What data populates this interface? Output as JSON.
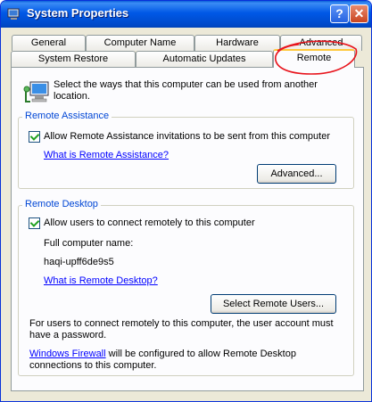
{
  "window": {
    "title": "System Properties",
    "help_glyph": "?",
    "close_glyph": "✕"
  },
  "tabs": {
    "row1": [
      "General",
      "Computer Name",
      "Hardware",
      "Advanced"
    ],
    "row2": [
      "System Restore",
      "Automatic Updates",
      "Remote"
    ],
    "active": "Remote"
  },
  "intro": "Select the ways that this computer can be used from another location.",
  "remote_assistance": {
    "title": "Remote Assistance",
    "checkbox_label": "Allow Remote Assistance invitations to be sent from this computer",
    "checked": true,
    "link": "What is Remote Assistance?",
    "advanced_button": "Advanced..."
  },
  "remote_desktop": {
    "title": "Remote Desktop",
    "checkbox_label": "Allow users to connect remotely to this computer",
    "checked": true,
    "computer_name_label": "Full computer name:",
    "computer_name": "haqi-upff6de9s5",
    "link": "What is Remote Desktop?",
    "select_users_button": "Select Remote Users...",
    "note": "For users to connect remotely to this computer, the user account must have a password.",
    "firewall_link": "Windows Firewall",
    "firewall_text": " will be configured to allow Remote Desktop connections to this computer."
  },
  "colors": {
    "titlebar": "#0058e6",
    "group_title": "#0046d5",
    "link": "#0000ff",
    "annotation": "#e8141c"
  }
}
